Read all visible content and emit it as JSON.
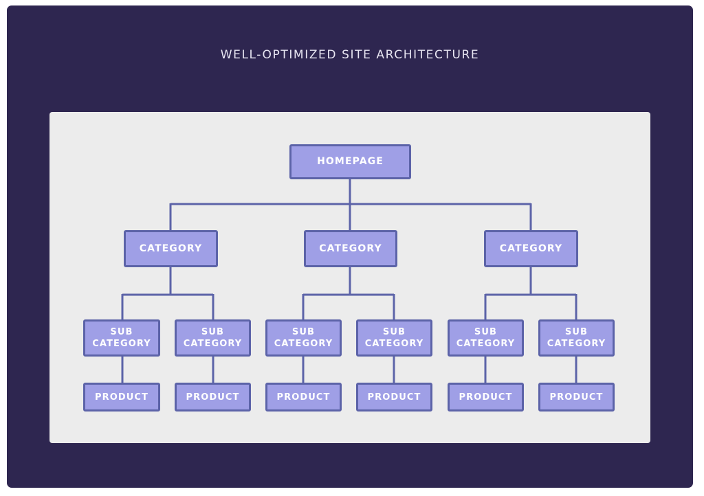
{
  "title": "WELL-OPTIMIZED SITE ARCHITECTURE",
  "colors": {
    "background_panel": "#2e2650",
    "diagram_panel": "#ececec",
    "node_fill": "#9f9fe6",
    "node_border": "#5c63a8",
    "connector": "#5c63a8",
    "title_text": "#e8e6f2"
  },
  "tree": {
    "root": {
      "label": "HOMEPAGE"
    },
    "categories": [
      {
        "label": "CATEGORY",
        "subcategories": [
          {
            "label": "SUB\nCATEGORY",
            "product": "PRODUCT"
          },
          {
            "label": "SUB\nCATEGORY",
            "product": "PRODUCT"
          }
        ]
      },
      {
        "label": "CATEGORY",
        "subcategories": [
          {
            "label": "SUB\nCATEGORY",
            "product": "PRODUCT"
          },
          {
            "label": "SUB\nCATEGORY",
            "product": "PRODUCT"
          }
        ]
      },
      {
        "label": "CATEGORY",
        "subcategories": [
          {
            "label": "SUB\nCATEGORY",
            "product": "PRODUCT"
          },
          {
            "label": "SUB\nCATEGORY",
            "product": "PRODUCT"
          }
        ]
      }
    ]
  }
}
